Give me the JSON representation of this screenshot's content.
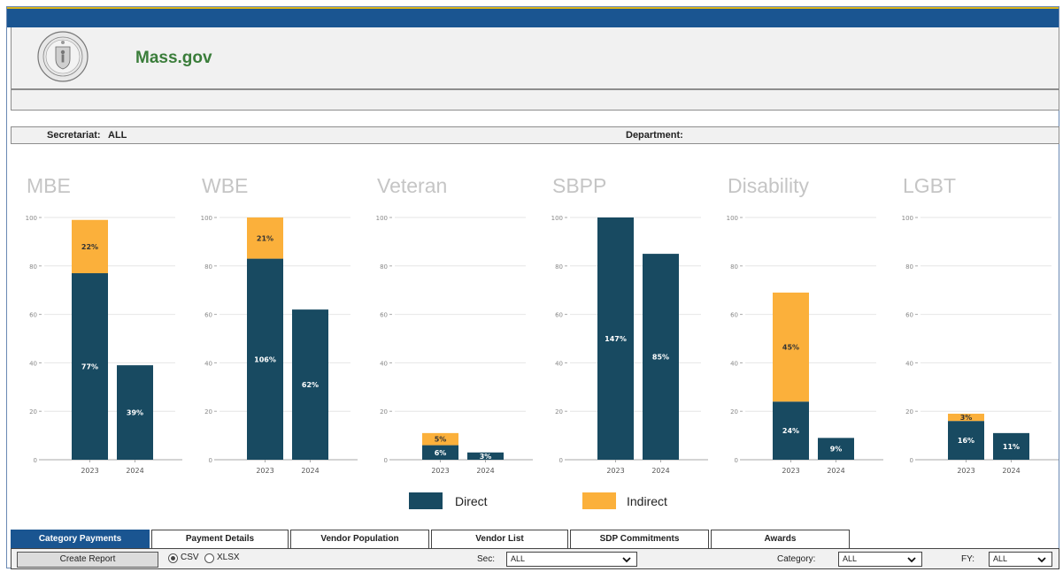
{
  "header": {
    "brand": "Mass.gov"
  },
  "filters": {
    "secretariat_label": "Secretariat:",
    "secretariat_value": "ALL",
    "department_label": "Department:"
  },
  "legend": {
    "direct_label": "Direct",
    "indirect_label": "Indirect",
    "direct_color": "#184a61",
    "indirect_color": "#fbb03b"
  },
  "tabs": [
    {
      "label": "Category Payments",
      "active": true
    },
    {
      "label": "Payment Details",
      "active": false
    },
    {
      "label": "Vendor Population",
      "active": false
    },
    {
      "label": "Vendor List",
      "active": false
    },
    {
      "label": "SDP Commitments",
      "active": false
    },
    {
      "label": "Awards",
      "active": false
    }
  ],
  "controls": {
    "create_report": "Create Report",
    "csv_label": "CSV",
    "xlsx_label": "XLSX",
    "sec_label": "Sec:",
    "sec_value": "ALL",
    "category_label": "Category:",
    "category_value": "ALL",
    "fy_label": "FY:",
    "fy_value": "ALL"
  },
  "chart_data": [
    {
      "type": "bar",
      "stacked": true,
      "title": "MBE",
      "categories": [
        "2023",
        "2024"
      ],
      "ylim": [
        0,
        100
      ],
      "yticks": [
        0,
        20,
        40,
        60,
        80,
        100
      ],
      "series": [
        {
          "name": "Direct",
          "values": [
            77,
            39
          ],
          "labels": [
            "77%",
            "39%"
          ]
        },
        {
          "name": "Indirect",
          "values": [
            22,
            0
          ],
          "labels": [
            "22%",
            ""
          ]
        }
      ]
    },
    {
      "type": "bar",
      "stacked": true,
      "title": "WBE",
      "categories": [
        "2023",
        "2024"
      ],
      "ylim": [
        0,
        100
      ],
      "yticks": [
        0,
        20,
        40,
        60,
        80,
        100
      ],
      "series": [
        {
          "name": "Direct",
          "values": [
            83,
            62
          ],
          "labels": [
            "106%",
            "62%"
          ]
        },
        {
          "name": "Indirect",
          "values": [
            17,
            0
          ],
          "labels": [
            "21%",
            ""
          ]
        }
      ]
    },
    {
      "type": "bar",
      "stacked": true,
      "title": "Veteran",
      "categories": [
        "2023",
        "2024"
      ],
      "ylim": [
        0,
        100
      ],
      "yticks": [
        0,
        20,
        40,
        60,
        80,
        100
      ],
      "series": [
        {
          "name": "Direct",
          "values": [
            6,
            3
          ],
          "labels": [
            "6%",
            "3%"
          ]
        },
        {
          "name": "Indirect",
          "values": [
            5,
            0
          ],
          "labels": [
            "5%",
            ""
          ]
        }
      ]
    },
    {
      "type": "bar",
      "stacked": true,
      "title": "SBPP",
      "categories": [
        "2023",
        "2024"
      ],
      "ylim": [
        0,
        100
      ],
      "yticks": [
        0,
        20,
        40,
        60,
        80,
        100
      ],
      "series": [
        {
          "name": "Direct",
          "values": [
            100,
            85
          ],
          "labels": [
            "147%",
            "85%"
          ]
        },
        {
          "name": "Indirect",
          "values": [
            0,
            0
          ],
          "labels": [
            "",
            ""
          ]
        }
      ]
    },
    {
      "type": "bar",
      "stacked": true,
      "title": "Disability",
      "categories": [
        "2023",
        "2024"
      ],
      "ylim": [
        0,
        100
      ],
      "yticks": [
        0,
        20,
        40,
        60,
        80,
        100
      ],
      "series": [
        {
          "name": "Direct",
          "values": [
            24,
            9
          ],
          "labels": [
            "24%",
            "9%"
          ]
        },
        {
          "name": "Indirect",
          "values": [
            45,
            0
          ],
          "labels": [
            "45%",
            ""
          ]
        }
      ]
    },
    {
      "type": "bar",
      "stacked": true,
      "title": "LGBT",
      "categories": [
        "2023",
        "2024"
      ],
      "ylim": [
        0,
        100
      ],
      "yticks": [
        0,
        20,
        40,
        60,
        80,
        100
      ],
      "series": [
        {
          "name": "Direct",
          "values": [
            16,
            11
          ],
          "labels": [
            "16%",
            "11%"
          ]
        },
        {
          "name": "Indirect",
          "values": [
            3,
            0
          ],
          "labels": [
            "3%",
            ""
          ]
        }
      ]
    }
  ]
}
